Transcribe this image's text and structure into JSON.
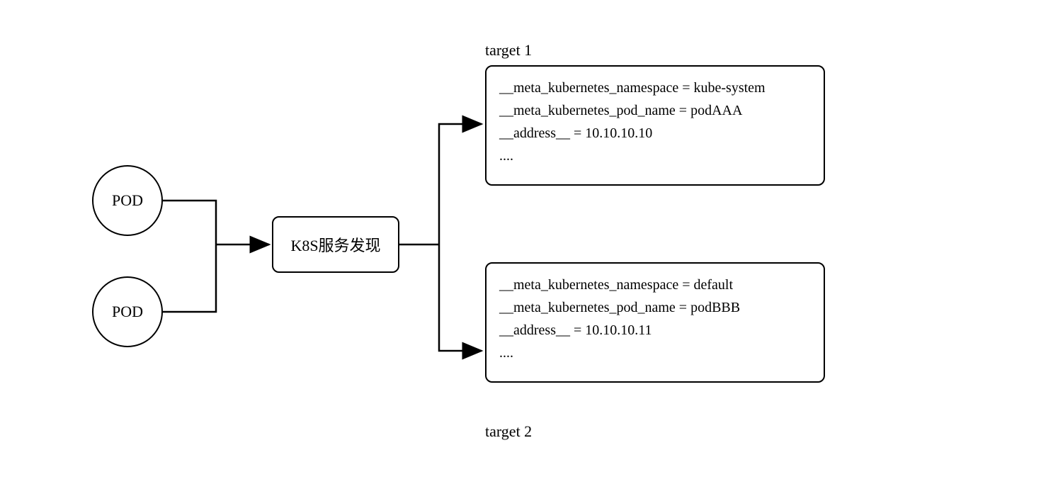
{
  "pods": [
    {
      "label": "POD"
    },
    {
      "label": "POD"
    }
  ],
  "service": {
    "label": "K8S服务发现"
  },
  "targets": [
    {
      "title": "target 1",
      "lines": [
        "__meta_kubernetes_namespace = kube-system",
        "__meta_kubernetes_pod_name = podAAA",
        "__address__ = 10.10.10.10",
        "...."
      ]
    },
    {
      "title": "target 2",
      "lines": [
        "__meta_kubernetes_namespace = default",
        "__meta_kubernetes_pod_name = podBBB",
        "__address__ = 10.10.10.11",
        "...."
      ]
    }
  ]
}
